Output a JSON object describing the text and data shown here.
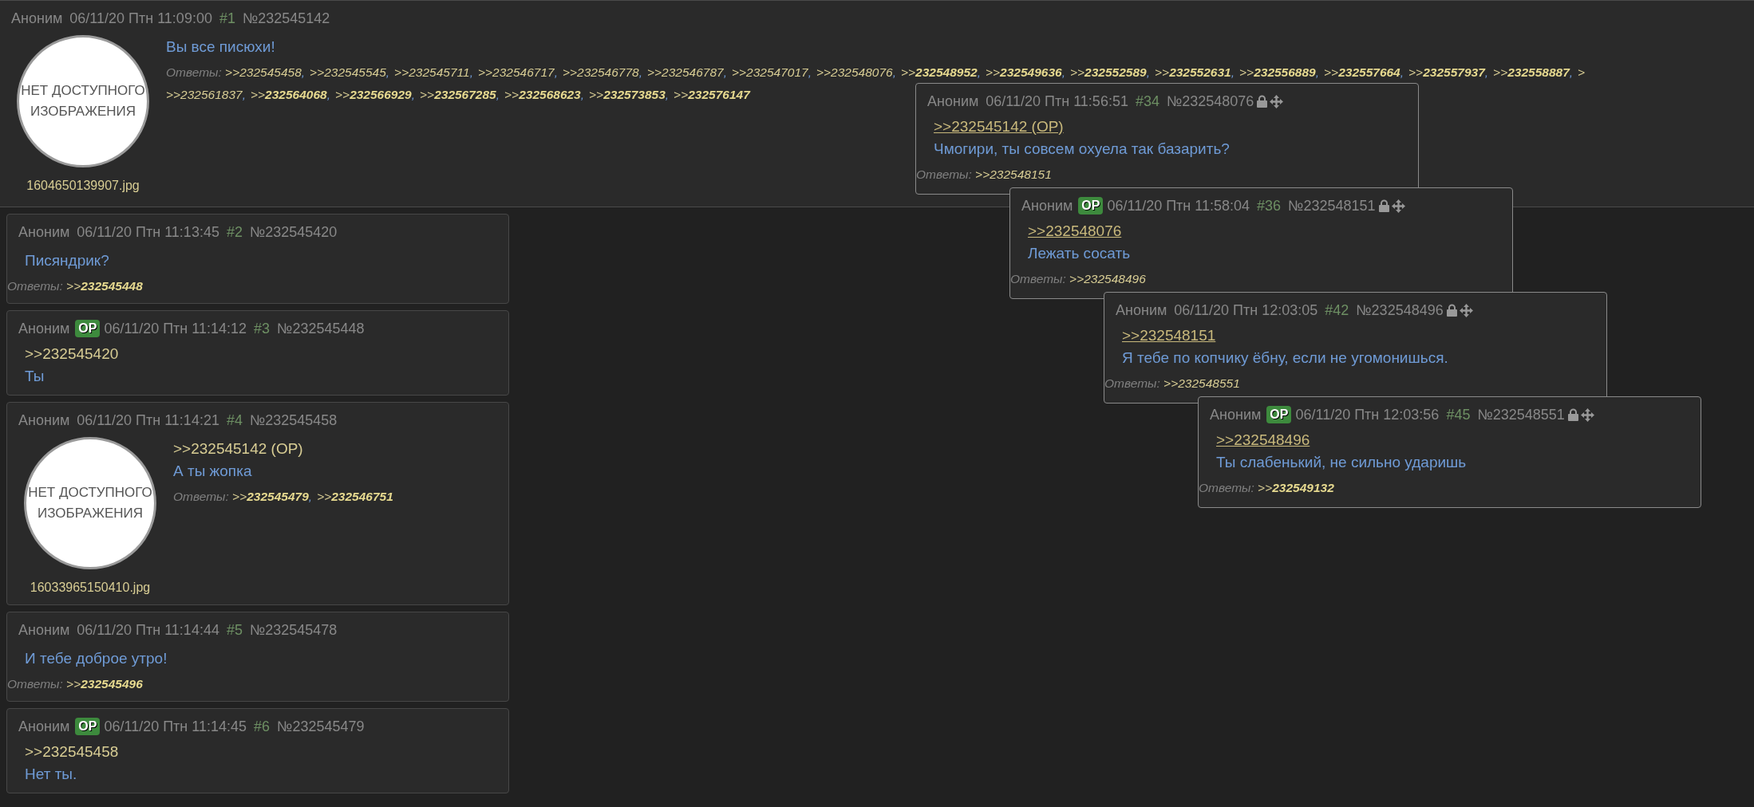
{
  "op_post": {
    "name": "Аноним",
    "date": "06/11/20 Птн 11:09:00",
    "num": "#1",
    "id": "№232545142",
    "thumbnail": {
      "text": "НЕТ ДОСТУПНОГО ИЗОБРАЖЕНИЯ",
      "filename": "1604650139907.jpg"
    },
    "message": "Вы все писюхи!",
    "replies_label": "Ответы:",
    "replies": [
      [
        {
          "t": ">>232545458",
          "sep": ","
        },
        {
          "t": ">>232545545",
          "sep": ","
        },
        {
          "t": ">>232545711",
          "sep": ","
        },
        {
          "t": ">>232546717",
          "sep": ","
        },
        {
          "t": ">>232546778",
          "sep": ","
        },
        {
          "t": ">>232546787",
          "sep": ","
        },
        {
          "t": ">>232547017",
          "sep": ","
        },
        {
          "t": ">>232548076",
          "sep": ","
        },
        {
          "t": ">>**232548952**",
          "sep": ","
        },
        {
          "t": ">>**232549636**",
          "sep": ","
        },
        {
          "t": ">>**232552589**",
          "sep": ","
        },
        {
          "t": ">>**232552631**",
          "sep": ","
        },
        {
          "t": ">>**232556889**",
          "sep": ","
        },
        {
          "t": ">>**232557664**",
          "sep": ","
        },
        {
          "t": ">>**232557937**",
          "sep": ","
        },
        {
          "t": ">>**232558887**",
          "sep": ","
        },
        {
          "t": ">"
        }
      ],
      [
        {
          "t": ">>232561837",
          "sep": ","
        },
        {
          "t": ">>**232564068**",
          "sep": ","
        },
        {
          "t": ">>**232566929**",
          "sep": ","
        },
        {
          "t": ">>**232567285**",
          "sep": ","
        },
        {
          "t": ">>**232568623**",
          "sep": ","
        },
        {
          "t": ">>**232573853**",
          "sep": ","
        },
        {
          "t": ">>**232576147**"
        }
      ]
    ]
  },
  "posts": [
    {
      "name": "Аноним",
      "date": "06/11/20 Птн 11:13:45",
      "num": "#2",
      "id": "№232545420",
      "message": "Писяндрик?",
      "replies_label": "Ответы:",
      "replies": [
        [
          {
            "t": ">>**232545448**"
          }
        ]
      ]
    },
    {
      "name": "Аноним",
      "badge": "OP",
      "date": "06/11/20 Птн 11:14:12",
      "num": "#3",
      "id": "№232545448",
      "quote": ">>232545420",
      "message": "Ты"
    },
    {
      "name": "Аноним",
      "date": "06/11/20 Птн 11:14:21",
      "num": "#4",
      "id": "№232545458",
      "thumbnail": {
        "text": "НЕТ ДОСТУПНОГО ИЗОБРАЖЕНИЯ",
        "filename": "16033965150410.jpg"
      },
      "quote": ">>232545142 (OP)",
      "message": "А ты жопка",
      "replies_label": "Ответы:",
      "replies": [
        [
          {
            "t": ">>**232545479**",
            "sep": ","
          },
          {
            "t": ">>**232546751**"
          }
        ]
      ]
    },
    {
      "name": "Аноним",
      "date": "06/11/20 Птн 11:14:44",
      "num": "#5",
      "id": "№232545478",
      "message": "И тебе доброе утро!",
      "replies_label": "Ответы:",
      "replies": [
        [
          {
            "t": ">>**232545496**"
          }
        ]
      ]
    },
    {
      "name": "Аноним",
      "badge": "OP",
      "date": "06/11/20 Птн 11:14:45",
      "num": "#6",
      "id": "№232545479",
      "quote": ">>232545458",
      "message": "Нет ты."
    }
  ],
  "popups": [
    {
      "name": "Аноним",
      "date": "06/11/20 Птн 11:56:51",
      "num": "#34",
      "id": "№232548076",
      "quote": ">>232545142 (OP)",
      "message": "Чмогири, ты совсем охуела так базарить?",
      "replies_label": "Ответы:",
      "replies": [
        [
          {
            "t": ">>232548151"
          }
        ]
      ]
    },
    {
      "name": "Аноним",
      "badge": "OP",
      "date": "06/11/20 Птн 11:58:04",
      "num": "#36",
      "id": "№232548151",
      "quote": ">>232548076",
      "message": "Лежать сосать",
      "replies_label": "Ответы:",
      "replies": [
        [
          {
            "t": ">>232548496"
          }
        ]
      ]
    },
    {
      "name": "Аноним",
      "date": "06/11/20 Птн 12:03:05",
      "num": "#42",
      "id": "№232548496",
      "quote": ">>232548151",
      "message": "Я тебе по копчику ёбну, если не угомонишься.",
      "replies_label": "Ответы:",
      "replies": [
        [
          {
            "t": ">>232548551"
          }
        ]
      ]
    },
    {
      "name": "Аноним",
      "badge": "OP",
      "date": "06/11/20 Птн 12:03:56",
      "num": "#45",
      "id": "№232548551",
      "quote": ">>232548496",
      "message": "Ты слабенький, не сильно ударишь",
      "replies_label": "Ответы:",
      "replies": [
        [
          {
            "t": ">>**232549132**"
          }
        ]
      ]
    }
  ]
}
